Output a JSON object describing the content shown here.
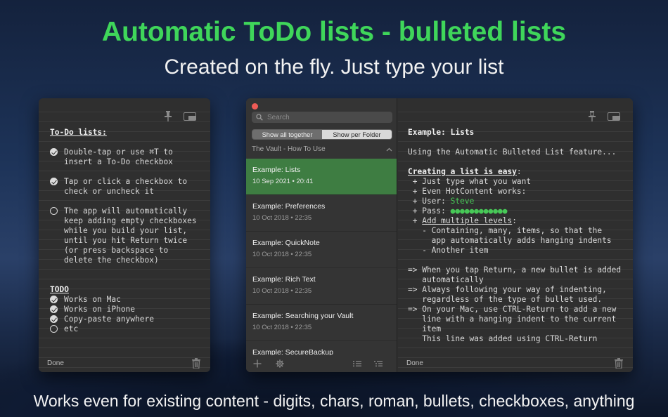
{
  "headline": "Automatic ToDo lists - bulleted lists",
  "subhead": "Created on the fly. Just type your list",
  "footer": "Works even for existing content - digits, chars, roman, bullets, checkboxes, anything",
  "left_note": {
    "heading": "To-Do lists:",
    "items": [
      {
        "checked": true,
        "text": "Double-tap or use ⌘T to\ninsert a To-Do checkbox"
      },
      {
        "checked": true,
        "text": "Tap or click a checkbox to\ncheck or uncheck it"
      },
      {
        "checked": false,
        "text": "The app will automatically\nkeep adding empty checkboxes\nwhile you build your list,\nuntil you hit Return twice\n(or press backspace to\ndelete the checkbox)"
      }
    ],
    "todo_heading": "TODO",
    "todo_items": [
      {
        "checked": true,
        "text": "Works on Mac"
      },
      {
        "checked": true,
        "text": "Works on iPhone"
      },
      {
        "checked": true,
        "text": "Copy-paste anywhere"
      },
      {
        "checked": false,
        "text": "etc"
      }
    ],
    "done_label": "Done"
  },
  "sidebar": {
    "search_placeholder": "Search",
    "segments": [
      "Show all together",
      "Show per Folder"
    ],
    "vault_title": "The Vault - How To Use",
    "notes": [
      {
        "title": "Example: Lists",
        "date": "10 Sep 2021 • 20:41"
      },
      {
        "title": "Example: Preferences",
        "date": "10 Oct 2018 • 22:35"
      },
      {
        "title": "Example: QuickNote",
        "date": "10 Oct 2018 • 22:35"
      },
      {
        "title": "Example: Rich Text",
        "date": "10 Oct 2018 • 22:35"
      },
      {
        "title": "Example: Searching your Vault",
        "date": "10 Oct 2018 • 22:35"
      },
      {
        "title": "Example: SecureBackup",
        "date": ""
      }
    ]
  },
  "editor": {
    "title": "Example: Lists",
    "intro": "Using the Automatic Bulleted List feature...",
    "creating_heading": "Creating a list is easy",
    "colon": ":",
    "bullet_1": " + Just type what you want",
    "bullet_2": " + Even HotContent works:",
    "user_prefix": " + User: ",
    "user_value": "Steve",
    "pass_prefix": " + Pass: ",
    "pass_value": "●●●●●●●●●●●●",
    "levels_prefix": " + ",
    "levels_heading": "Add multiple levels",
    "sub_1": "   - Containing, many, items, so that the",
    "sub_1b": "     app automatically adds hanging indents",
    "sub_2": "   - Another item",
    "arrow_1": "=> When you tap Return, a new bullet is added",
    "arrow_1b": "   automatically",
    "arrow_2": "=> Always following your way of indenting,",
    "arrow_2b": "   regardless of the type of bullet used.",
    "arrow_3": "=> On your Mac, use CTRL-Return to add a new",
    "arrow_3b": "   line with a hanging indent to the current",
    "arrow_3c": "   item",
    "arrow_3d": "   This line was added using CTRL-Return",
    "done_label": "Done"
  },
  "colors": {
    "accent_green": "#3fd65a",
    "selected_row": "#3e7d42",
    "close_button": "#ef5b56"
  }
}
